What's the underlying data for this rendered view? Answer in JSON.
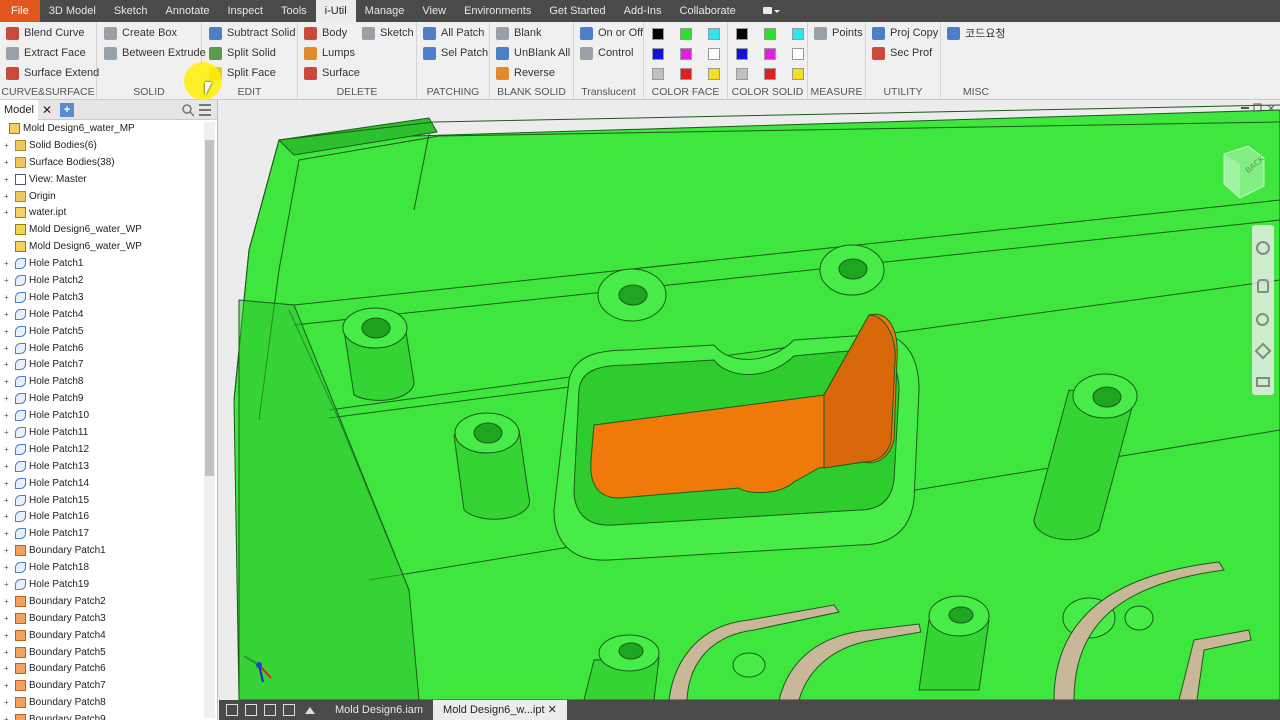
{
  "menubar": {
    "tabs": [
      "File",
      "3D Model",
      "Sketch",
      "Annotate",
      "Inspect",
      "Tools",
      "i-Util",
      "Manage",
      "View",
      "Environments",
      "Get Started",
      "Add-Ins",
      "Collaborate"
    ],
    "active": "i-Util"
  },
  "ribbon": {
    "panels": {
      "curve_surface": {
        "title": "CURVE&SURFACE",
        "items": [
          "Blend Curve",
          "Extract Face",
          "Surface Extend"
        ]
      },
      "solid": {
        "title": "SOLID",
        "items": [
          "Create Box",
          "Between Extrude"
        ]
      },
      "edit": {
        "title": "EDIT",
        "items": [
          "Subtract Solid",
          "Split Solid",
          "Split Face"
        ]
      },
      "delete": {
        "title": "DELETE",
        "items": [
          "Body",
          "Lumps",
          "Surface",
          "Sketch"
        ]
      },
      "patching": {
        "title": "PATCHING",
        "items": [
          "All Patch",
          "Sel Patch"
        ]
      },
      "blank_solid": {
        "title": "BLANK SOLID",
        "items": [
          "Blank",
          "UnBlank All",
          "Reverse"
        ]
      },
      "translucent": {
        "title": "Translucent",
        "items": [
          "On or Off",
          "Control"
        ]
      },
      "color_face": {
        "title": "COLOR FACE"
      },
      "color_solid": {
        "title": "COLOR SOLID"
      },
      "measure": {
        "title": "MEASURE",
        "items": [
          "Points"
        ]
      },
      "utility": {
        "title": "UTILITY",
        "items": [
          "Proj Copy",
          "Sec Prof"
        ]
      },
      "misc": {
        "title": "MISC",
        "items": [
          "코드요청"
        ]
      }
    },
    "swatch_colors": [
      "#000000",
      "#2ae02a",
      "#2ee6ee",
      "#1111dd",
      "#e020e0",
      "#ffffff",
      "#c0c0c0",
      "#e02020",
      "#f0e020"
    ]
  },
  "sidebar": {
    "tab_label": "Model",
    "nodes": [
      {
        "label": "Mold Design6_water_MP",
        "icon": "part",
        "exp": ""
      },
      {
        "label": "Solid Bodies(6)",
        "icon": "folder",
        "exp": "+"
      },
      {
        "label": "Surface Bodies(38)",
        "icon": "folder",
        "exp": "+"
      },
      {
        "label": "View: Master",
        "icon": "view",
        "exp": "+"
      },
      {
        "label": "Origin",
        "icon": "folder",
        "exp": "+"
      },
      {
        "label": "water.ipt",
        "icon": "part",
        "exp": "+"
      },
      {
        "label": "Mold Design6_water_WP",
        "icon": "part",
        "exp": ""
      },
      {
        "label": "Mold Design6_water_WP",
        "icon": "part",
        "exp": ""
      },
      {
        "label": "Hole Patch1",
        "icon": "patch",
        "exp": "+"
      },
      {
        "label": "Hole Patch2",
        "icon": "patch",
        "exp": "+"
      },
      {
        "label": "Hole Patch3",
        "icon": "patch",
        "exp": "+"
      },
      {
        "label": "Hole Patch4",
        "icon": "patch",
        "exp": "+"
      },
      {
        "label": "Hole Patch5",
        "icon": "patch",
        "exp": "+"
      },
      {
        "label": "Hole Patch6",
        "icon": "patch",
        "exp": "+"
      },
      {
        "label": "Hole Patch7",
        "icon": "patch",
        "exp": "+"
      },
      {
        "label": "Hole Patch8",
        "icon": "patch",
        "exp": "+"
      },
      {
        "label": "Hole Patch9",
        "icon": "patch",
        "exp": "+"
      },
      {
        "label": "Hole Patch10",
        "icon": "patch",
        "exp": "+"
      },
      {
        "label": "Hole Patch11",
        "icon": "patch",
        "exp": "+"
      },
      {
        "label": "Hole Patch12",
        "icon": "patch",
        "exp": "+"
      },
      {
        "label": "Hole Patch13",
        "icon": "patch",
        "exp": "+"
      },
      {
        "label": "Hole Patch14",
        "icon": "patch",
        "exp": "+"
      },
      {
        "label": "Hole Patch15",
        "icon": "patch",
        "exp": "+"
      },
      {
        "label": "Hole Patch16",
        "icon": "patch",
        "exp": "+"
      },
      {
        "label": "Hole Patch17",
        "icon": "patch",
        "exp": "+"
      },
      {
        "label": "Boundary Patch1",
        "icon": "bpatch",
        "exp": "+"
      },
      {
        "label": "Hole Patch18",
        "icon": "patch",
        "exp": "+"
      },
      {
        "label": "Hole Patch19",
        "icon": "patch",
        "exp": "+"
      },
      {
        "label": "Boundary Patch2",
        "icon": "bpatch",
        "exp": "+"
      },
      {
        "label": "Boundary Patch3",
        "icon": "bpatch",
        "exp": "+"
      },
      {
        "label": "Boundary Patch4",
        "icon": "bpatch",
        "exp": "+"
      },
      {
        "label": "Boundary Patch5",
        "icon": "bpatch",
        "exp": "+"
      },
      {
        "label": "Boundary Patch6",
        "icon": "bpatch",
        "exp": "+"
      },
      {
        "label": "Boundary Patch7",
        "icon": "bpatch",
        "exp": "+"
      },
      {
        "label": "Boundary Patch8",
        "icon": "bpatch",
        "exp": "+"
      },
      {
        "label": "Boundary Patch9",
        "icon": "bpatch",
        "exp": "+"
      }
    ]
  },
  "viewcube": {
    "face_label": "BACK"
  },
  "statusbar": {
    "documents": [
      "Mold Design6.iam",
      "Mold Design6_w...ipt"
    ],
    "active": 1
  },
  "colors": {
    "model_green": "#3ee63e",
    "cavity_orange": "#ef7a0a",
    "file_tab": "#e2571e"
  }
}
